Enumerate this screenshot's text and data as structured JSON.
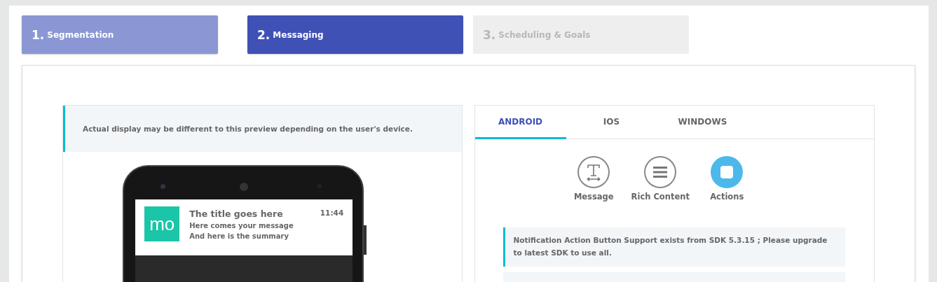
{
  "steps": [
    {
      "number": "1.",
      "label": "Segmentation",
      "selected": false,
      "disabled": false
    },
    {
      "number": "2.",
      "label": "Messaging",
      "selected": true,
      "disabled": false
    },
    {
      "number": "3.",
      "label": "Scheduling & Goals",
      "selected": false,
      "disabled": true
    }
  ],
  "preview": {
    "note": "Actual display may be different to this preview depending on the user's device.",
    "notification": {
      "logo": "mo",
      "title": "The title goes here",
      "time": "11:44",
      "message": "Here comes your message",
      "summary": "And here is the summary"
    }
  },
  "platform_tabs": [
    {
      "label": "ANDROID",
      "selected": true
    },
    {
      "label": "IOS",
      "selected": false
    },
    {
      "label": "WINDOWS",
      "selected": false
    }
  ],
  "content_types": [
    {
      "kind": "text",
      "label": "Message",
      "selected": false
    },
    {
      "kind": "list",
      "label": "Rich Content",
      "selected": false
    },
    {
      "kind": "square",
      "label": "Actions",
      "selected": true
    }
  ],
  "sdk_note": "Notification Action Button Support exists from SDK 5.3.15 ; Please upgrade to latest SDK to use all."
}
